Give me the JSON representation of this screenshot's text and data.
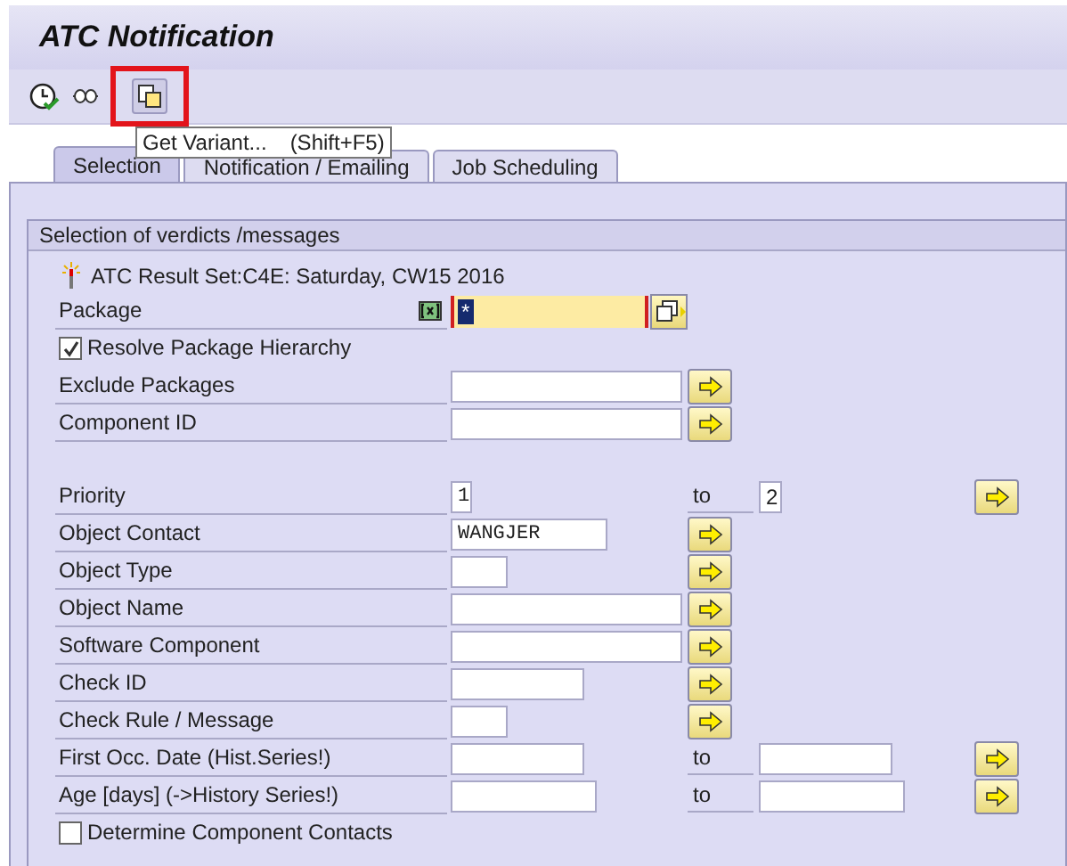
{
  "window": {
    "title": "ATC Notification"
  },
  "toolbar": [
    {
      "kind": "clock",
      "highlighted": false
    },
    {
      "kind": "glasses",
      "highlighted": false
    },
    {
      "kind": "variant",
      "highlighted": true
    }
  ],
  "tooltip": {
    "label": "Get Variant...",
    "shortcut": "(Shift+F5)"
  },
  "tabs": [
    {
      "label": "Selection",
      "selected": true
    },
    {
      "label": "Notification / Emailing",
      "selected": false
    },
    {
      "label": "Job Scheduling",
      "selected": false
    }
  ],
  "group": {
    "title": "Selection of verdicts /messages",
    "info": "ATC Result Set:C4E: Saturday, CW15 2016",
    "rows": [
      [
        {
          "kind": "package",
          "label": "Package",
          "value": "*"
        },
        {
          "kind": "checkbox",
          "label": "Resolve Package Hierarchy",
          "checked": true
        },
        {
          "kind": "select",
          "label": "Exclude Packages"
        },
        {
          "kind": "select",
          "label": "Component ID"
        }
      ],
      [
        {
          "kind": "range",
          "label": "Priority",
          "value": "1",
          "to_label": "to",
          "to_value": "2"
        },
        {
          "kind": "select",
          "label": "Object Contact",
          "value": "WANGJER"
        },
        {
          "kind": "select",
          "label": "Object Type"
        },
        {
          "kind": "select",
          "label": "Object Name"
        },
        {
          "kind": "select",
          "label": "Software Component"
        },
        {
          "kind": "select",
          "label": "Check ID"
        },
        {
          "kind": "select",
          "label": "Check Rule / Message"
        },
        {
          "kind": "range",
          "label": "First Occ. Date (Hist.Series!)",
          "to_label": "to"
        },
        {
          "kind": "range",
          "label": "Age [days] (->History Series!)",
          "to_label": "to"
        },
        {
          "kind": "checkbox",
          "label": "Determine Component Contacts",
          "checked": false
        }
      ]
    ]
  }
}
